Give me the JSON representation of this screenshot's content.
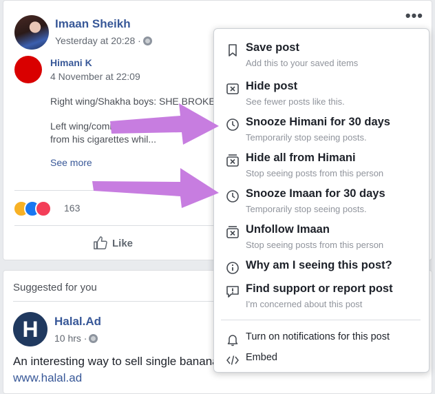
{
  "post": {
    "author": "Imaan Sheikh",
    "time": "Yesterday at 20:28 ·",
    "shared": {
      "author": "Himani K",
      "time": "4 November at 22:09",
      "text_line1": "Right wing/Shakha boys: SHE BROKE",
      "text_line2": "Left wing/comrades:",
      "text_line3": "from his cigarettes whil...",
      "see_more": "See more"
    },
    "reaction_count": "163",
    "like_label": "Like"
  },
  "suggested": {
    "title": "Suggested for you",
    "page_name": "Halal.Ad",
    "page_initial": "H",
    "time": "10 hrs ·",
    "ad_text": "An interesting way to sell single banana",
    "link": "www.halal.ad"
  },
  "menu": {
    "items": [
      {
        "title": "Save post",
        "sub": "Add this to your saved items",
        "icon": "bookmark-icon"
      },
      {
        "title": "Hide post",
        "sub": "See fewer posts like this.",
        "icon": "hide-icon"
      },
      {
        "title": "Snooze Himani for 30 days",
        "sub": "Temporarily stop seeing posts.",
        "icon": "clock-icon"
      },
      {
        "title": "Hide all from Himani",
        "sub": "Stop seeing posts from this person",
        "icon": "hide-all-icon"
      },
      {
        "title": "Snooze Imaan for 30 days",
        "sub": "Temporarily stop seeing posts.",
        "icon": "clock-icon"
      },
      {
        "title": "Unfollow Imaan",
        "sub": "Stop seeing posts from this person",
        "icon": "unfollow-icon"
      },
      {
        "title": "Why am I seeing this post?",
        "sub": "",
        "icon": "info-icon"
      },
      {
        "title": "Find support or report post",
        "sub": "I'm concerned about this post",
        "icon": "report-icon"
      },
      {
        "title": "Turn on notifications for this post",
        "icon": "bell-icon"
      },
      {
        "title": "Embed",
        "icon": "code-icon"
      }
    ]
  },
  "colors": {
    "link_blue": "#385898",
    "annotation_arrow": "#c77de0"
  }
}
